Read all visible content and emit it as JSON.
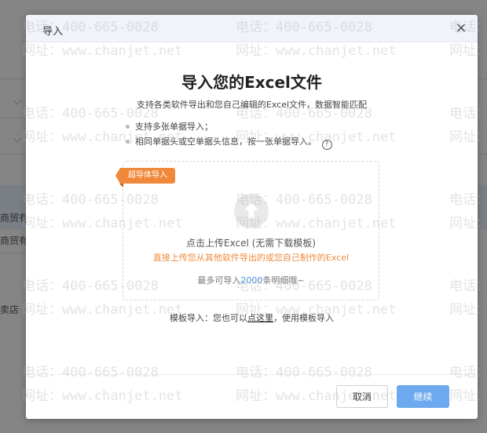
{
  "background": {
    "row_texts": [
      "商贸有",
      "商贸有",
      "卖店"
    ]
  },
  "dialog": {
    "title": "导入",
    "close_glyph": "×",
    "heading": "导入您的Excel文件",
    "subtitle": "支持各类软件导出和您自己编辑的Excel文件，数据智能匹配",
    "bullets": [
      "支持多张单据导入；",
      "相同单据头或空单据头信息，按一张单据导入。"
    ],
    "help_glyph": "?",
    "tag": "超导体导入",
    "upload_main": "点击上传Excel (无需下载模板)",
    "upload_sub": "直接上传您从其他软件导出的或您自己制作的Excel",
    "limit_prefix": "最多可导入",
    "limit_number": "2000",
    "limit_suffix": "条明细哦~",
    "template_prefix": "模板导入：您也可以",
    "template_link": "点这里",
    "template_suffix": "，使用模板导入",
    "cancel_label": "取消",
    "continue_label": "继续"
  },
  "watermark": {
    "phone": "电话：400-665-0028",
    "site": "网址：www.chanjet.net"
  },
  "colors": {
    "accent_orange": "#f0883a",
    "primary_blue": "#6ca9ee",
    "link_blue": "#4a90e2"
  }
}
